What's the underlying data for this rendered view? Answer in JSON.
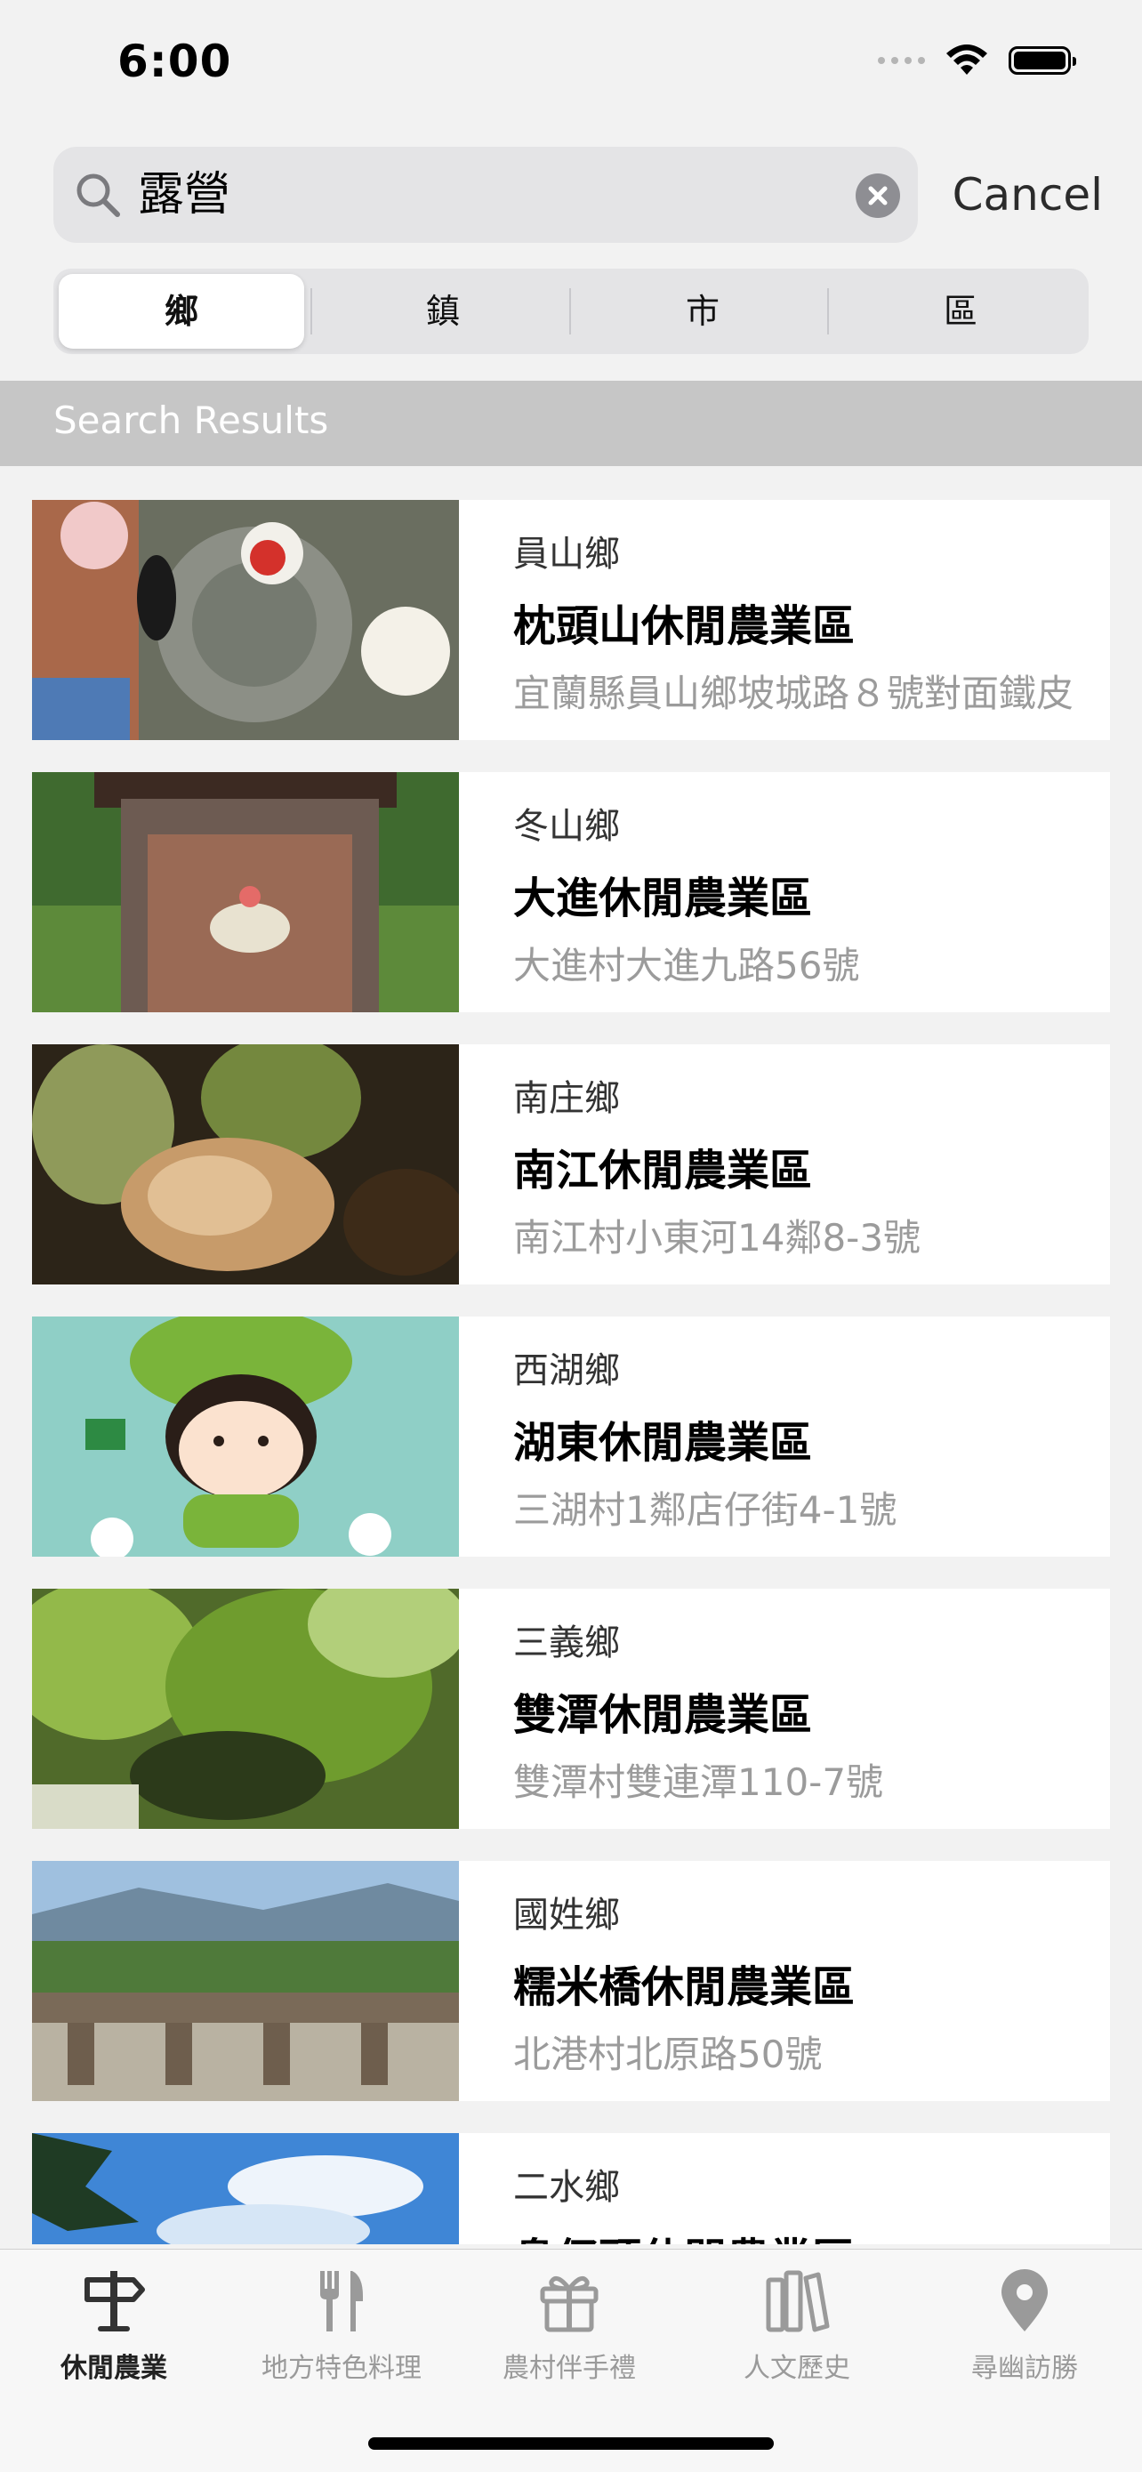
{
  "status_bar": {
    "time": "6:00"
  },
  "search": {
    "query": "露營",
    "cancel_label": "Cancel"
  },
  "segments": [
    {
      "label": "鄉",
      "selected": true
    },
    {
      "label": "鎮",
      "selected": false
    },
    {
      "label": "市",
      "selected": false
    },
    {
      "label": "區",
      "selected": false
    }
  ],
  "results_header": "Search Results",
  "results": [
    {
      "town": "員山鄉",
      "title": "枕頭山休閒農業區",
      "address": "宜蘭縣員山鄉坡城路８號對面鐵皮"
    },
    {
      "town": "冬山鄉",
      "title": "大進休閒農業區",
      "address": "大進村大進九路56號"
    },
    {
      "town": "南庄鄉",
      "title": "南江休閒農業區",
      "address": "南江村小東河14鄰8-3號"
    },
    {
      "town": "西湖鄉",
      "title": "湖東休閒農業區",
      "address": "三湖村1鄰店仔街4-1號"
    },
    {
      "town": "三義鄉",
      "title": "雙潭休閒農業區",
      "address": "雙潭村雙連潭110-7號"
    },
    {
      "town": "國姓鄉",
      "title": "糯米橋休閒農業區",
      "address": "北港村北原路50號"
    },
    {
      "town": "二水鄉",
      "title": "鼻仔頭休閒農業區",
      "address": ""
    }
  ],
  "tabbar": [
    {
      "label": "休閒農業",
      "icon": "signpost-icon",
      "selected": true
    },
    {
      "label": "地方特色料理",
      "icon": "fork-knife-icon",
      "selected": false
    },
    {
      "label": "農村伴手禮",
      "icon": "gift-icon",
      "selected": false
    },
    {
      "label": "人文歷史",
      "icon": "books-icon",
      "selected": false
    },
    {
      "label": "尋幽訪勝",
      "icon": "map-pin-icon",
      "selected": false
    }
  ]
}
